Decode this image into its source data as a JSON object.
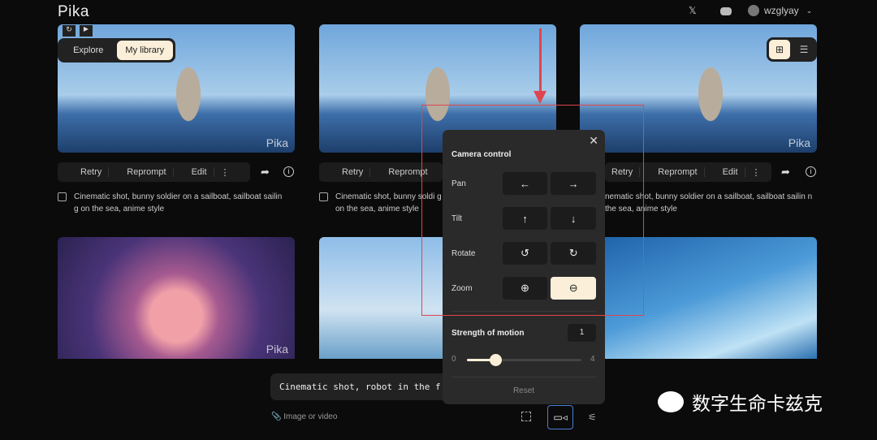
{
  "header": {
    "logo": "Pika",
    "username": "wzglyay",
    "icons": [
      "x-icon",
      "discord-icon",
      "avatar",
      "chevron-down-icon"
    ]
  },
  "nav": {
    "tabs": [
      "Explore",
      "My library"
    ],
    "active": "My library"
  },
  "view_toggle": {
    "active": "grid"
  },
  "cards": [
    {
      "watermark": "Pika",
      "actions": [
        "Retry",
        "Reprompt",
        "Edit"
      ],
      "caption": "Cinematic shot, bunny soldier on a sailboat, sailboat sailin g on the sea, anime style"
    },
    {
      "watermark": "",
      "actions": [
        "Retry",
        "Reprompt"
      ],
      "caption": "Cinematic shot, bunny soldi g on the sea, anime style"
    },
    {
      "watermark": "Pika",
      "actions": [
        "Retry",
        "Reprompt",
        "Edit"
      ],
      "caption": "nematic shot, bunny soldier on a sailboat, sailboat sailin n the sea, anime style"
    }
  ],
  "row2_watermark": "Pika",
  "camera": {
    "title": "Camera control",
    "pan": "Pan",
    "tilt": "Tilt",
    "rotate": "Rotate",
    "zoom": "Zoom",
    "active": "zoom-out",
    "strength_label": "Strength of motion",
    "strength": "1",
    "min": "0",
    "max": "4",
    "strength_value": 1,
    "reset": "Reset"
  },
  "prompt": {
    "value": "Cinematic shot, robot in the f",
    "attach": "Image or video"
  },
  "overlay_watermark": "数字生命卡兹克",
  "colors": {
    "accent": "#fbefd9",
    "annotation": "#e0454f"
  }
}
